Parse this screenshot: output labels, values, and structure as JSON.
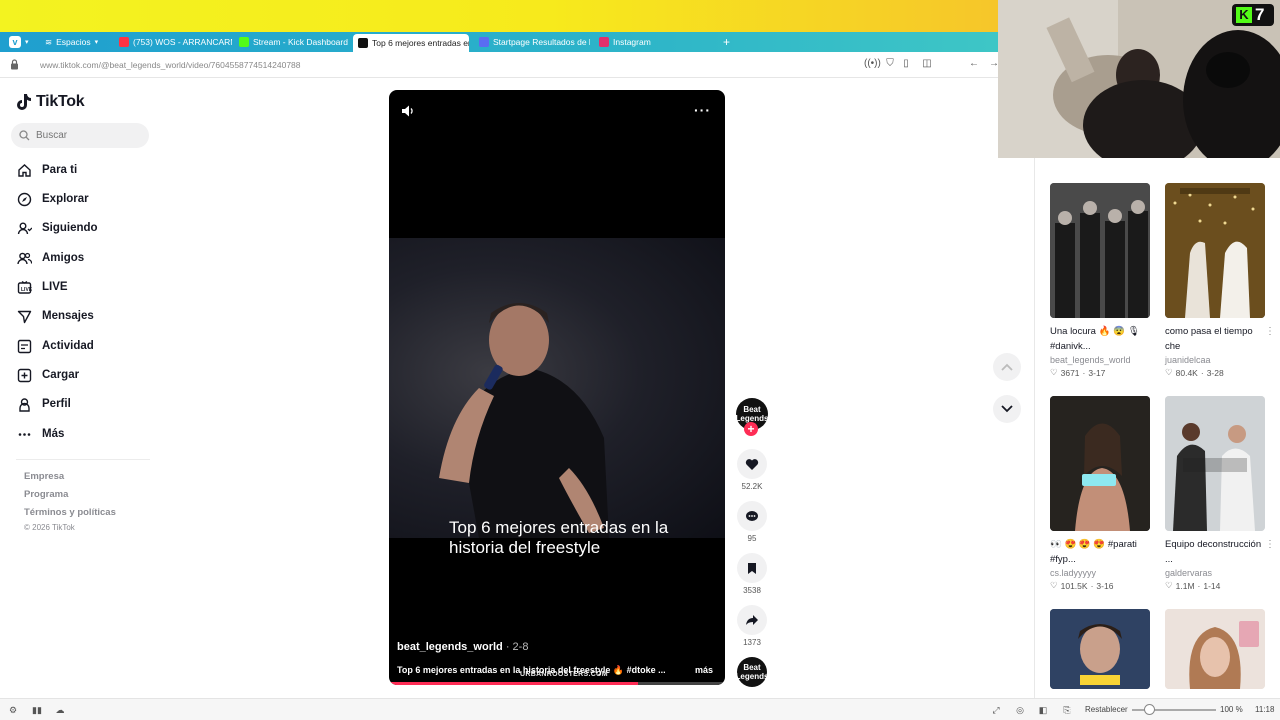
{
  "browser": {
    "tabs": [
      {
        "label": "Espacios",
        "fav_color": "#ffffff"
      },
      {
        "label": "(753) WOS - ARRANCARM",
        "fav_color": "#ff3344"
      },
      {
        "label": "Stream - Kick Dashboard",
        "fav_color": "#53fc18"
      },
      {
        "label": "Top 6 mejores entradas en",
        "fav_color": "#111111"
      },
      {
        "label": "Startpage Resultados de b",
        "fav_color": "#5a6cf2"
      },
      {
        "label": "Instagram",
        "fav_color": "#e1306c"
      }
    ],
    "new_tab": "+",
    "url": "www.tiktok.com/@beat_legends_world/video/7604558774514240788"
  },
  "webcam": {
    "badge_number": "7"
  },
  "sidebar": {
    "logo": "TikTok",
    "search_placeholder": "Buscar",
    "items": [
      {
        "label": "Para ti",
        "icon": "home-icon"
      },
      {
        "label": "Explorar",
        "icon": "compass-icon"
      },
      {
        "label": "Siguiendo",
        "icon": "following-icon"
      },
      {
        "label": "Amigos",
        "icon": "friends-icon"
      },
      {
        "label": "LIVE",
        "icon": "live-icon"
      },
      {
        "label": "Mensajes",
        "icon": "send-icon"
      },
      {
        "label": "Actividad",
        "icon": "activity-icon"
      },
      {
        "label": "Cargar",
        "icon": "upload-icon"
      },
      {
        "label": "Perfil",
        "icon": "profile-icon"
      },
      {
        "label": "Más",
        "icon": "more-icon"
      }
    ],
    "footer": [
      "Empresa",
      "Programa",
      "Términos y políticas"
    ],
    "copyright": "© 2026 TikTok"
  },
  "video": {
    "caption_overlay": "Top 6 mejores entradas en la historia del freestyle",
    "watermark": "URBANROOSTERS.COM",
    "author": "beat_legends_world",
    "date": " · 2-8",
    "description": "Top 6 mejores entradas en la historia del freestyle 🔥 #dtoke ...",
    "more": "más",
    "progress": 0.74
  },
  "actions": {
    "likes": "52.2K",
    "comments": "95",
    "saves": "3538",
    "shares": "1373",
    "avatar_text": "Beat Legends"
  },
  "recommended": [
    {
      "title": "Una locura 🔥 😨 🎙 #danivk...",
      "user": "beat_legends_world",
      "likes": "3671",
      "date": "3-17"
    },
    {
      "title": "como pasa el tiempo che",
      "user": "juanidelcaa",
      "likes": "80.4K",
      "date": "3-28"
    },
    {
      "title": "👀 😍 😍 😍 #parati #fyp...",
      "user": "cs.ladyyyyy",
      "likes": "101.5K",
      "date": "3-16"
    },
    {
      "title": "Equipo deconstrucción ...",
      "user": "galdervaras",
      "likes": "1.1M",
      "date": "1-14"
    },
    {
      "title": "",
      "user": "",
      "likes": "",
      "date": ""
    },
    {
      "title": "",
      "user": "",
      "likes": "",
      "date": ""
    }
  ],
  "statusbar": {
    "reset": "Restablecer",
    "zoom": "100 %",
    "time": "11:18"
  }
}
